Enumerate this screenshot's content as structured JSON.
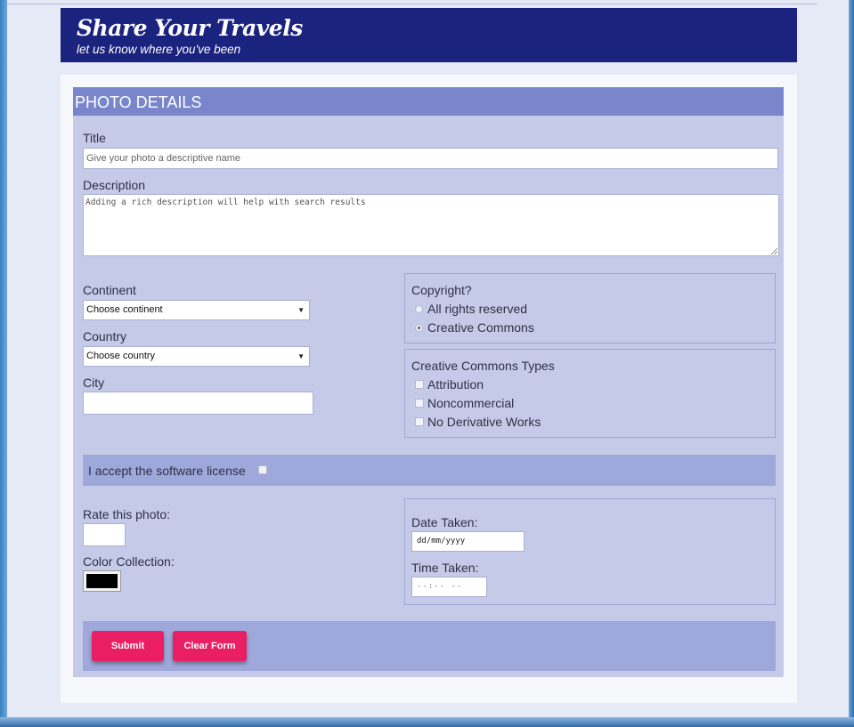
{
  "colors": {
    "header_bg": "#1a237e",
    "panel_title_bg": "#7986cb",
    "panel_bg": "#c5cae9",
    "band_bg": "#9fa8da",
    "button_bg": "#e91e63",
    "color_value": "#000000"
  },
  "header": {
    "title": "Share Your Travels",
    "subtitle": "let us know where you've been"
  },
  "form": {
    "panel_title": "PHOTO DETAILS",
    "title": {
      "label": "Title",
      "placeholder": "Give your photo a descriptive name"
    },
    "description": {
      "label": "Description",
      "placeholder": "Adding a rich description will help with search results"
    },
    "continent": {
      "label": "Continent",
      "selected": "Choose continent",
      "arrow_icon": "dropdown-arrow-icon"
    },
    "country": {
      "label": "Country",
      "selected": "Choose country",
      "arrow_icon": "dropdown-arrow-icon"
    },
    "city": {
      "label": "City",
      "value": ""
    },
    "copyright": {
      "legend": "Copyright?",
      "options": [
        {
          "label": "All rights reserved",
          "checked": false
        },
        {
          "label": "Creative Commons",
          "checked": true
        }
      ]
    },
    "cc_types": {
      "legend": "Creative Commons Types",
      "options": [
        {
          "label": "Attribution",
          "checked": false
        },
        {
          "label": "Noncommercial",
          "checked": false
        },
        {
          "label": "No Derivative Works",
          "checked": false
        }
      ]
    },
    "license": {
      "label": "I accept the software license",
      "checked": false
    },
    "rate": {
      "label": "Rate this photo:",
      "value": ""
    },
    "color": {
      "label": "Color Collection:"
    },
    "date": {
      "label": "Date Taken:",
      "placeholder": "dd/mm/yyyy"
    },
    "time": {
      "label": "Time Taken:",
      "placeholder": "--:-- --"
    },
    "buttons": {
      "submit": "Submit",
      "clear": "Clear Form"
    }
  }
}
